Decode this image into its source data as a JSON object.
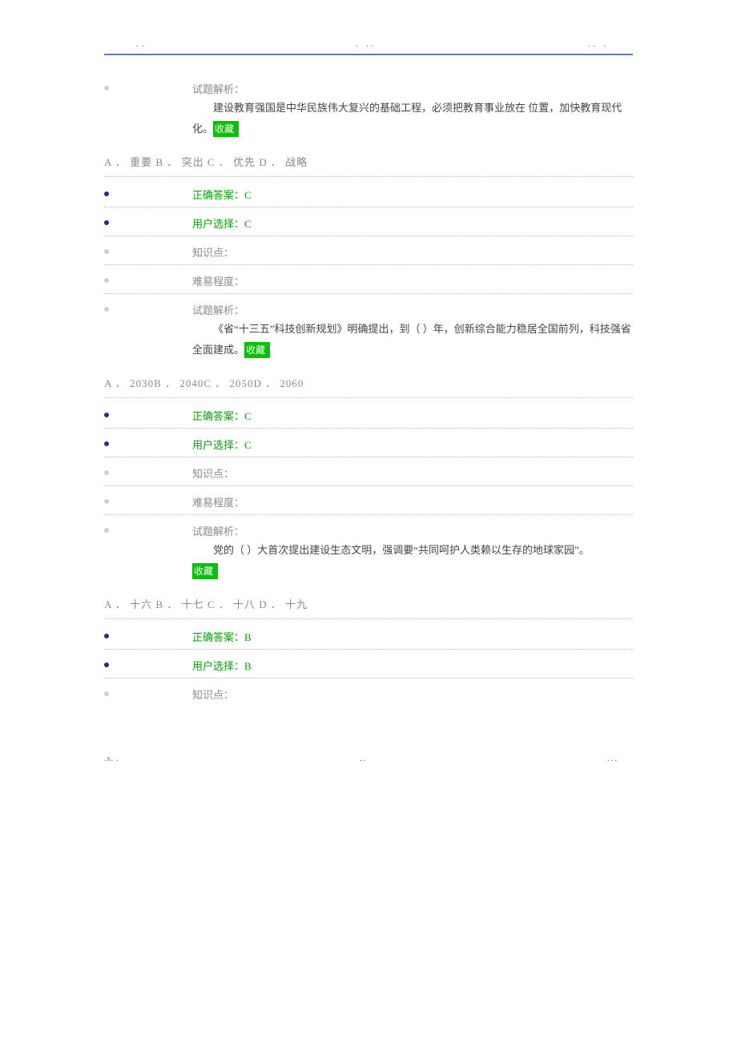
{
  "header": {
    "left": ". .",
    "mid": ".   ..",
    "right": ".. ."
  },
  "labels": {
    "analysis": "试题解析：",
    "correct_answer_prefix": "正确答案：",
    "user_choice_prefix": "用户选择：",
    "knowledge_point": "知识点：",
    "difficulty": "难易程度：",
    "favorite": "收藏"
  },
  "questions": [
    {
      "text": "建设教育强国是中华民族伟大复兴的基础工程，必须把教育事业放在 位置，加快教育现代化。",
      "options_text": "A ． 重要 B ． 突出 C ． 优先 D ． 战略",
      "correct": "C",
      "user": "C"
    },
    {
      "text": "《省“十三五”科技创新规划》明确提出，到（ ）年，创新综合能力稳居全国前列，科技强省全面建成。",
      "options_text": "A ． 2030B ． 2040C ． 2050D ． 2060",
      "correct": "C",
      "user": "C"
    },
    {
      "text": "党的（ ）大首次提出建设生态文明，强调要“共同呵护人类赖以生存的地球家园”。",
      "options_text": "A ． 十六 B ． 十七 C ． 十八 D ． 十九",
      "correct": "B",
      "user": "B"
    }
  ],
  "footer": {
    "left": ".s. .",
    "mid": "..",
    "right": "..."
  }
}
